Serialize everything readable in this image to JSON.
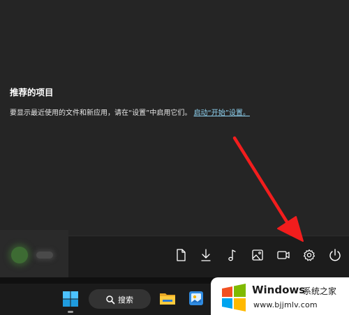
{
  "recommended": {
    "title": "推荐的项目",
    "description": "要显示最近使用的文件和新应用，请在“设置”中启用它们。",
    "link_text": "启动“开始”设置。"
  },
  "footer": {
    "icons": [
      "document-icon",
      "download-icon",
      "music-icon",
      "picture-icon",
      "video-icon",
      "settings-icon",
      "power-icon"
    ]
  },
  "taskbar": {
    "search_label": "搜索"
  },
  "watermark": {
    "title": "Windows",
    "title_suffix": "系统之家",
    "url": "www.bjjmlv.com"
  },
  "colors": {
    "link": "#8fd3f2",
    "arrow": "#f21d1d",
    "windows_blue": "#1e90ff"
  }
}
